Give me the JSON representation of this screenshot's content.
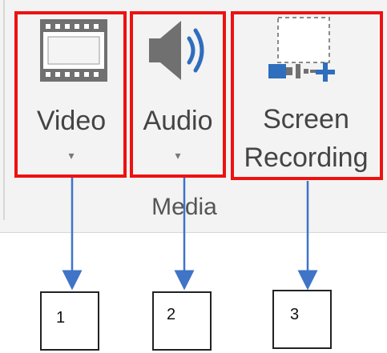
{
  "ribbon": {
    "buttons": [
      {
        "id": "video",
        "label": "Video",
        "caret": "▾"
      },
      {
        "id": "audio",
        "label": "Audio",
        "caret": "▾"
      },
      {
        "id": "screen",
        "label_line1": "Screen",
        "label_line2": "Recording"
      }
    ],
    "group_label": "Media"
  },
  "callouts": [
    {
      "number": "1"
    },
    {
      "number": "2"
    },
    {
      "number": "3"
    }
  ],
  "colors": {
    "highlight": "#ee1111",
    "arrow": "#3f74c7",
    "icon_gray": "#707070",
    "accent_blue": "#2f6dbd"
  },
  "icons": [
    "film-strip-icon",
    "speaker-icon",
    "screen-recording-icon"
  ]
}
